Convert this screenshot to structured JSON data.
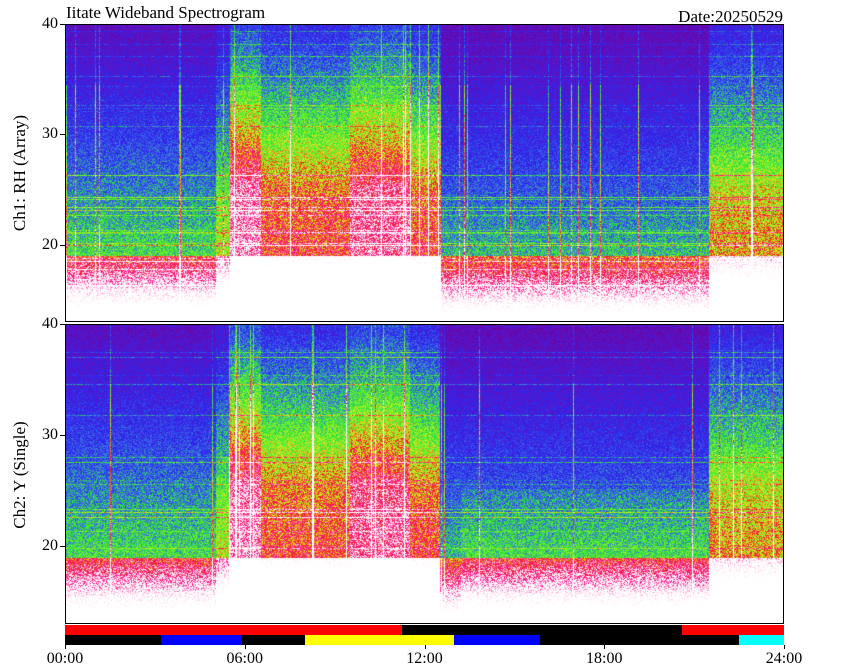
{
  "title": "Iitate Wideband Spectrogram",
  "date": "Date:20250529",
  "chart_data": [
    {
      "type": "heatmap",
      "ylabel": "Ch1: RH (Array)",
      "y_ticks": [
        20,
        30,
        40
      ],
      "ylim": [
        13,
        40
      ],
      "xlim": [
        0,
        24
      ]
    },
    {
      "type": "heatmap",
      "ylabel": "Ch2: Y (Single)",
      "y_ticks": [
        20,
        30,
        40
      ],
      "ylim": [
        13,
        40
      ],
      "xlim": [
        0,
        24
      ]
    }
  ],
  "x_ticks": [
    "00:00",
    "06:00",
    "12:00",
    "18:00",
    "24:00"
  ],
  "status_bar": {
    "row1": [
      {
        "start": 0,
        "end": 11.25,
        "color": "#ff0000"
      },
      {
        "start": 11.25,
        "end": 20.6,
        "color": "#000000"
      },
      {
        "start": 20.6,
        "end": 24,
        "color": "#ff0000"
      }
    ],
    "row2": [
      {
        "start": 0,
        "end": 3.2,
        "color": "#000000"
      },
      {
        "start": 3.2,
        "end": 5.9,
        "color": "#0000ff"
      },
      {
        "start": 5.9,
        "end": 8.0,
        "color": "#000000"
      },
      {
        "start": 8.0,
        "end": 13.0,
        "color": "#ffff00"
      },
      {
        "start": 13.0,
        "end": 15.85,
        "color": "#0000ff"
      },
      {
        "start": 15.85,
        "end": 22.5,
        "color": "#000000"
      },
      {
        "start": 22.5,
        "end": 24,
        "color": "#00ffff"
      }
    ]
  }
}
